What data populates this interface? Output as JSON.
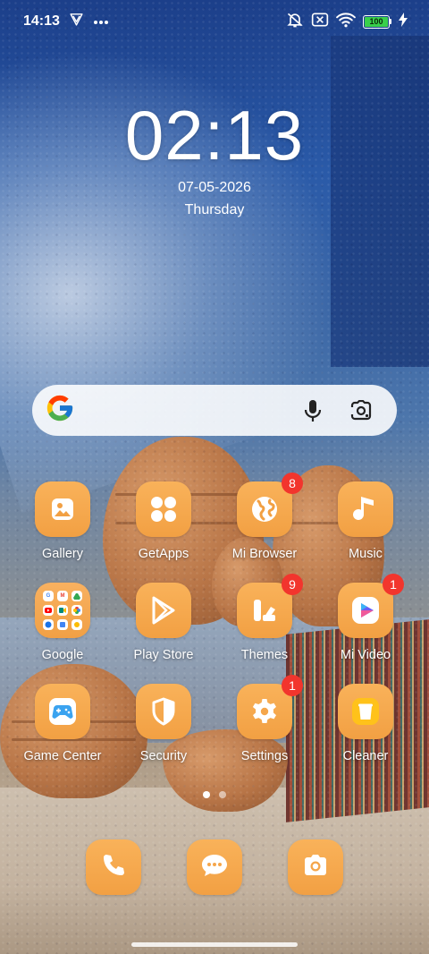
{
  "status_bar": {
    "time": "14:13",
    "battery_level": "100",
    "icons": [
      "vpn-icon",
      "more-dots-icon",
      "silent-bell-icon",
      "no-sim-icon",
      "wifi-icon",
      "battery-icon",
      "charging-icon"
    ]
  },
  "lockclock": {
    "time": "02:13",
    "date": "07-05-2026",
    "weekday": "Thursday"
  },
  "search": {
    "logo": "google-g-icon",
    "actions": [
      "microphone-icon",
      "google-lens-icon"
    ]
  },
  "apps": [
    {
      "label": "Gallery",
      "icon": "image-icon",
      "badge": ""
    },
    {
      "label": "GetApps",
      "icon": "four-dots-icon",
      "badge": ""
    },
    {
      "label": "Mi Browser",
      "icon": "globe-icon",
      "badge": "8"
    },
    {
      "label": "Music",
      "icon": "music-note-icon",
      "badge": ""
    },
    {
      "label": "Google",
      "icon": "folder-icon",
      "badge": ""
    },
    {
      "label": "Play Store",
      "icon": "play-store-icon",
      "badge": ""
    },
    {
      "label": "Themes",
      "icon": "brush-icon",
      "badge": "9"
    },
    {
      "label": "Mi Video",
      "icon": "play-icon",
      "badge": "1"
    },
    {
      "label": "Game Center",
      "icon": "gamepad-icon",
      "badge": ""
    },
    {
      "label": "Security",
      "icon": "shield-icon",
      "badge": ""
    },
    {
      "label": "Settings",
      "icon": "gear-icon",
      "badge": "1"
    },
    {
      "label": "Cleaner",
      "icon": "trash-icon",
      "badge": ""
    }
  ],
  "google_folder_glyphs": [
    "G",
    "M",
    "",
    "",
    "",
    "",
    "",
    "",
    ""
  ],
  "dock": [
    {
      "name": "phone",
      "icon": "phone-icon"
    },
    {
      "name": "messaging",
      "icon": "chat-icon"
    },
    {
      "name": "camera",
      "icon": "camera-icon"
    }
  ],
  "page_indicator": {
    "current": 1,
    "total": 2
  },
  "colors": {
    "app_icon": "#f5a64b",
    "badge": "#f2352d",
    "battery": "#39d04b"
  }
}
